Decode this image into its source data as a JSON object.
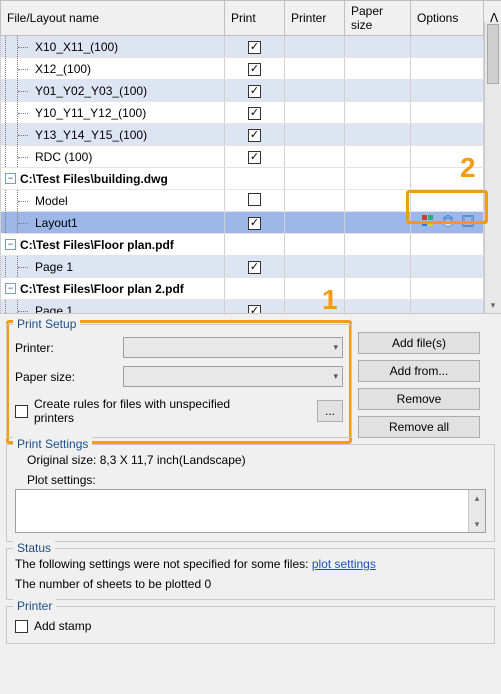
{
  "annotations": {
    "number1": "1",
    "number2": "2"
  },
  "columns": {
    "name": "File/Layout name",
    "print": "Print",
    "printer": "Printer",
    "paper": "Paper size",
    "options": "Options",
    "scroll": "ᐱ"
  },
  "rows": [
    {
      "type": "child",
      "alt": true,
      "name": "X10_X11_(100)",
      "print": true
    },
    {
      "type": "child",
      "alt": false,
      "name": "X12_(100)",
      "print": true
    },
    {
      "type": "child",
      "alt": true,
      "name": "Y01_Y02_Y03_(100)",
      "print": true
    },
    {
      "type": "child",
      "alt": false,
      "name": "Y10_Y11_Y12_(100)",
      "print": true
    },
    {
      "type": "child",
      "alt": true,
      "name": "Y13_Y14_Y15_(100)",
      "print": true
    },
    {
      "type": "child",
      "alt": false,
      "name": "RDC (100)",
      "print": true
    },
    {
      "type": "group",
      "name": "C:\\Test Files\\building.dwg"
    },
    {
      "type": "child",
      "alt": false,
      "name": "Model",
      "print": false
    },
    {
      "type": "child",
      "alt": false,
      "selected": true,
      "name": "Layout1",
      "print": true,
      "icons": true
    },
    {
      "type": "group",
      "name": "C:\\Test Files\\Floor plan.pdf"
    },
    {
      "type": "child",
      "alt": true,
      "name": "Page 1",
      "print": true
    },
    {
      "type": "group",
      "name": "C:\\Test Files\\Floor plan 2.pdf"
    },
    {
      "type": "child",
      "alt": true,
      "name": "Page 1",
      "print": true
    }
  ],
  "printSetup": {
    "legend": "Print Setup",
    "printerLabel": "Printer:",
    "printerValue": "",
    "paperLabel": "Paper size:",
    "paperValue": "",
    "rulesCheckbox": false,
    "rulesLabel": "Create rules for files with unspecified printers",
    "ellipsis": "..."
  },
  "buttons": {
    "addFiles": "Add file(s)",
    "addFrom": "Add from...",
    "remove": "Remove",
    "removeAll": "Remove all"
  },
  "printSettings": {
    "legend": "Print Settings",
    "originalSize": "Original size:  8,3 X 11,7 inch(Landscape)",
    "plotLabel": "Plot settings:"
  },
  "status": {
    "legend": "Status",
    "line1a": "The following settings were not specified for some files:  ",
    "link": "plot settings",
    "line2": "The number of sheets to be plotted  0"
  },
  "printer": {
    "legend": "Printer",
    "addStamp": false,
    "addStampLabel": "Add stamp"
  },
  "expander": "−"
}
